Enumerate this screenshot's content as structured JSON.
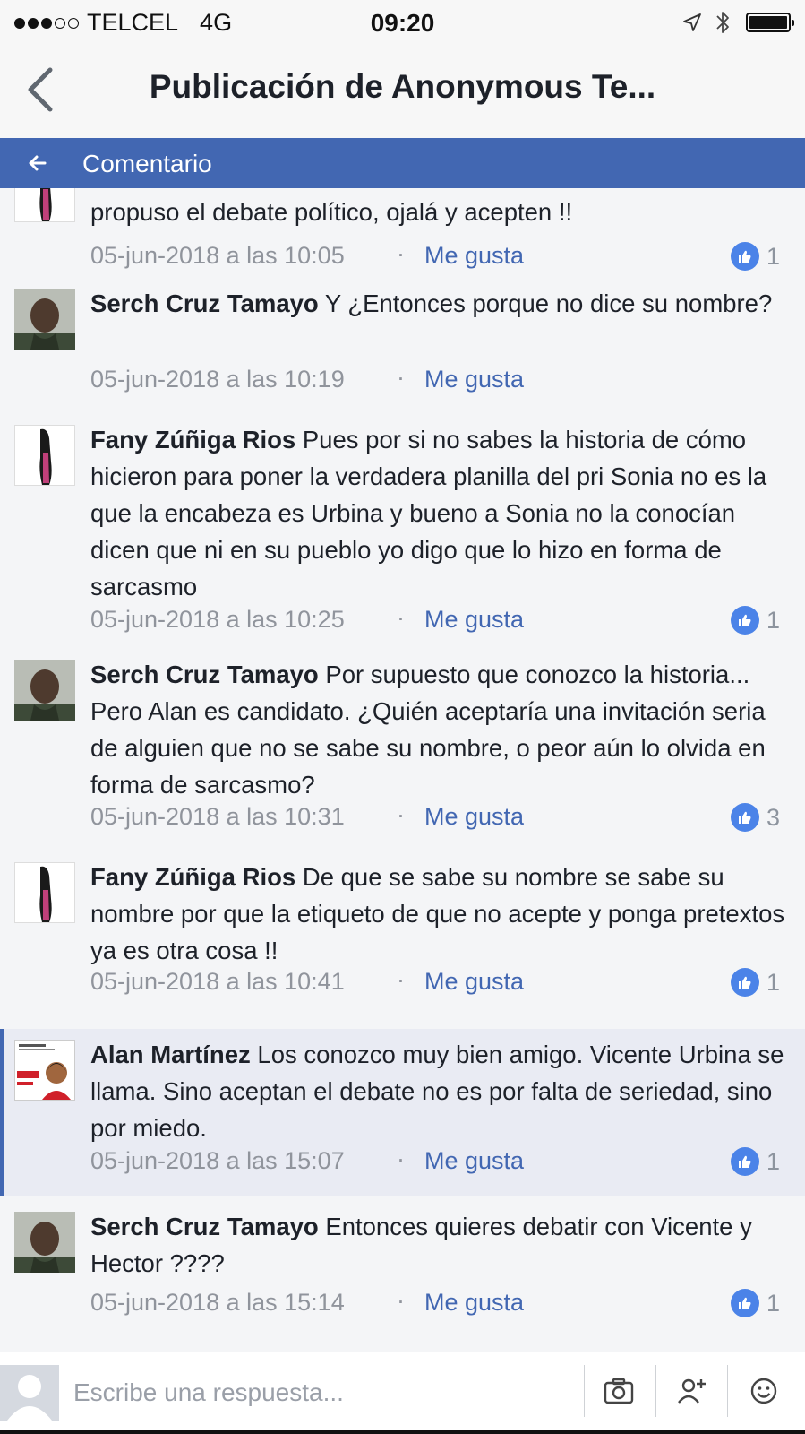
{
  "status_bar": {
    "carrier": "TELCEL",
    "network": "4G",
    "time": "09:20"
  },
  "nav": {
    "title": "Publicación de Anonymous Te..."
  },
  "header": {
    "title": "Comentario"
  },
  "comments": [
    {
      "author": "",
      "text": "propuso el debate político, ojalá y acepten !!",
      "date": "05-jun-2018 a las 10:05",
      "like_label": "Me gusta",
      "likes": "1",
      "avatar": "fany"
    },
    {
      "author": "Serch Cruz Tamayo",
      "text": "Y ¿Entonces porque no dice su nombre?",
      "date": "05-jun-2018 a las 10:19",
      "like_label": "Me gusta",
      "likes": "",
      "avatar": "serch"
    },
    {
      "author": "Fany Zúñiga Rios",
      "text": "Pues por si no sabes la historia de cómo hicieron para poner la verdadera planilla del pri Sonia no es la que la encabeza es Urbina y bueno a Sonia no la conocían dicen que ni en su pueblo yo digo que lo hizo en forma de sarcasmo",
      "date": "05-jun-2018 a las 10:25",
      "like_label": "Me gusta",
      "likes": "1",
      "avatar": "fany"
    },
    {
      "author": "Serch Cruz Tamayo",
      "text": "Por supuesto que conozco la historia... Pero Alan es candidato. ¿Quién aceptaría una invitación seria de alguien que no se sabe su nombre, o peor aún lo olvida en forma de sarcasmo?",
      "date": "05-jun-2018 a las 10:31",
      "like_label": "Me gusta",
      "likes": "3",
      "avatar": "serch"
    },
    {
      "author": "Fany Zúñiga Rios",
      "text": "De que se sabe su nombre se sabe su nombre por que la etiqueto de que no acepte y ponga pretextos ya es otra cosa !!",
      "date": "05-jun-2018 a las 10:41",
      "like_label": "Me gusta",
      "likes": "1",
      "avatar": "fany"
    },
    {
      "author": "Alan Martínez",
      "text": "Los conozco muy bien amigo. Vicente Urbina se llama. Sino aceptan el debate no es por falta de seriedad, sino por miedo.",
      "date": "05-jun-2018 a las 15:07",
      "like_label": "Me gusta",
      "likes": "1",
      "avatar": "alan",
      "highlighted": true
    },
    {
      "author": "Serch Cruz Tamayo",
      "text": "Entonces quieres debatir con Vicente y Hector ????",
      "date": "05-jun-2018 a las 15:14",
      "like_label": "Me gusta",
      "likes": "1",
      "avatar": "serch"
    }
  ],
  "reply": {
    "placeholder": "Escribe una respuesta..."
  },
  "icons": {
    "location": "location-arrow-icon",
    "bluetooth": "bluetooth-icon",
    "battery": "battery-icon",
    "like": "thumbs-up-icon",
    "camera": "camera-icon",
    "mention": "add-person-icon",
    "emoji": "smiley-icon"
  },
  "colors": {
    "brand": "#4267b2",
    "like_badge": "#4b83e8",
    "meta_text": "#90949c",
    "highlight_bg": "#e9ebf3"
  }
}
